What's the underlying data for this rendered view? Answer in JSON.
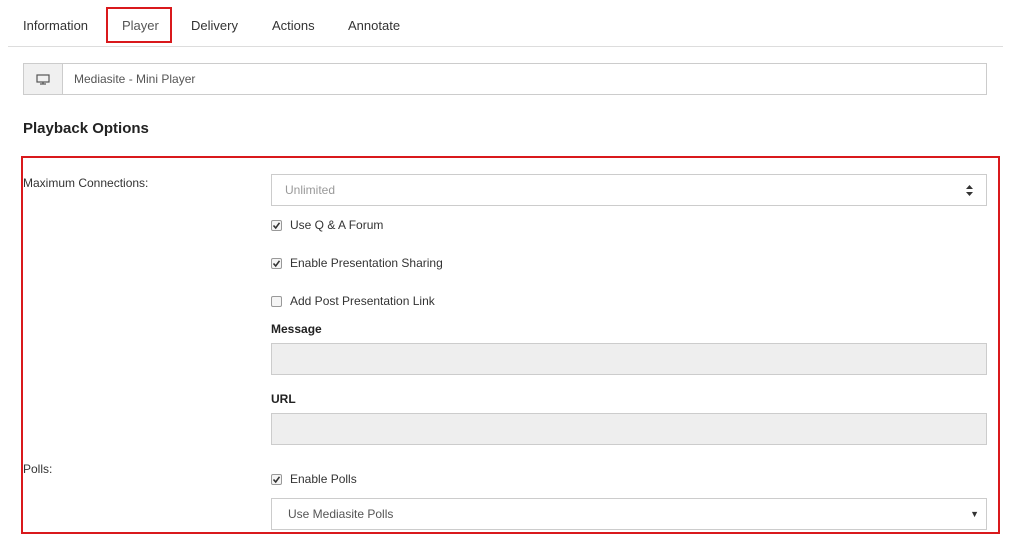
{
  "tabs": {
    "information": "Information",
    "player": "Player",
    "delivery": "Delivery",
    "actions": "Actions",
    "annotate": "Annotate"
  },
  "player_select": {
    "icon": "monitor-icon",
    "value": "Mediasite - Mini Player"
  },
  "section": {
    "title": "Playback Options"
  },
  "max_connections": {
    "label": "Maximum Connections:",
    "value": "Unlimited",
    "icon": "spinner-arrows-icon"
  },
  "options": {
    "qa_forum": {
      "label": "Use Q & A Forum",
      "checked": true
    },
    "presentation_sharing": {
      "label": "Enable Presentation Sharing",
      "checked": true
    },
    "post_presentation_link": {
      "label": "Add Post Presentation Link",
      "checked": false
    }
  },
  "message": {
    "label": "Message",
    "value": ""
  },
  "url": {
    "label": "URL",
    "value": ""
  },
  "polls": {
    "label": "Polls:",
    "enable_label": "Enable Polls",
    "enabled": true,
    "provider": "Use Mediasite Polls",
    "icon": "caret-down-icon"
  },
  "colors": {
    "highlight": "#d9191c",
    "disabled_field": "#eeeeee",
    "border": "#cccccc"
  }
}
